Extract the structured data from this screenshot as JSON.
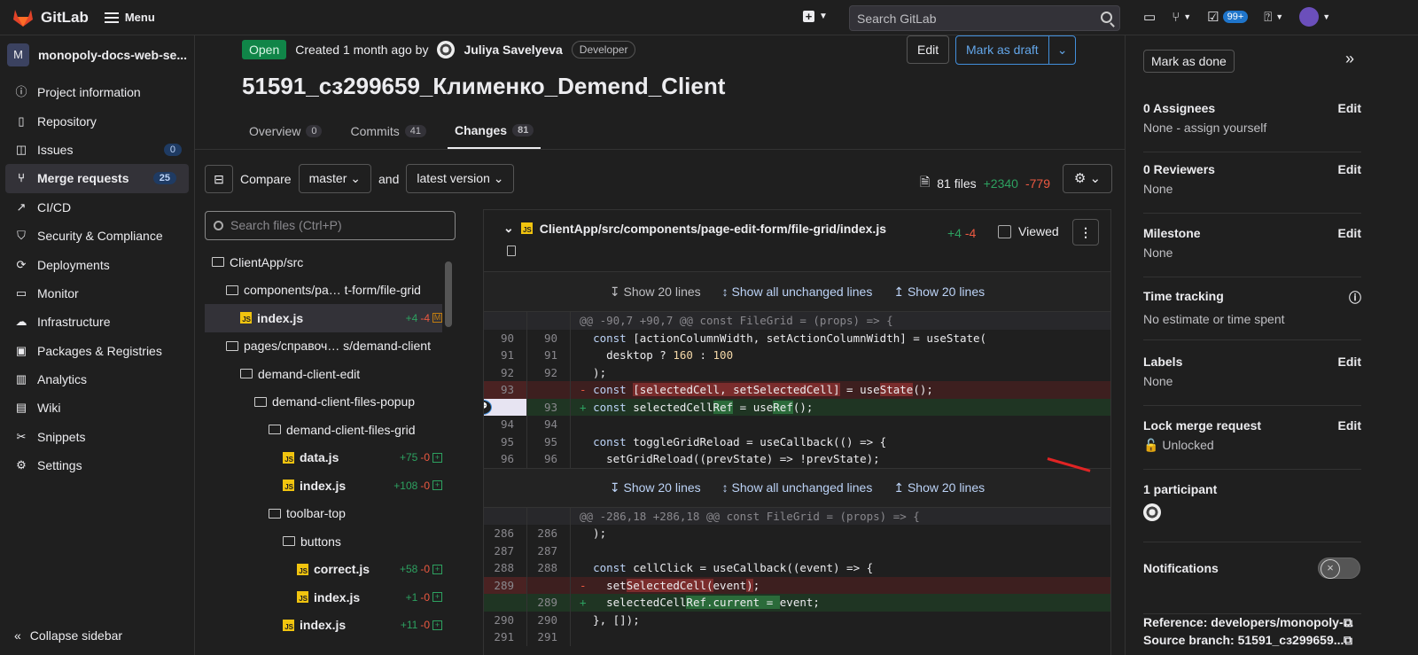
{
  "topbar": {
    "app": "GitLab",
    "menu": "Menu",
    "search_placeholder": "Search GitLab",
    "todos": "99+"
  },
  "sidebar": {
    "project": "monopoly-docs-web-se...",
    "items": [
      {
        "label": "Project information",
        "icon": "info-icon"
      },
      {
        "label": "Repository",
        "icon": "book-icon"
      },
      {
        "label": "Issues",
        "icon": "issues-icon",
        "badge": "0"
      },
      {
        "label": "Merge requests",
        "icon": "merge-icon",
        "badge": "25"
      },
      {
        "label": "CI/CD",
        "icon": "rocket-icon"
      },
      {
        "label": "Security & Compliance",
        "icon": "shield-icon"
      },
      {
        "label": "Deployments",
        "icon": "deploy-icon"
      },
      {
        "label": "Monitor",
        "icon": "monitor-icon"
      },
      {
        "label": "Infrastructure",
        "icon": "cloud-icon"
      },
      {
        "label": "Packages & Registries",
        "icon": "package-icon"
      },
      {
        "label": "Analytics",
        "icon": "chart-icon"
      },
      {
        "label": "Wiki",
        "icon": "wiki-icon"
      },
      {
        "label": "Snippets",
        "icon": "scissors-icon"
      },
      {
        "label": "Settings",
        "icon": "gear-icon"
      }
    ],
    "collapse": "Collapse sidebar"
  },
  "mr": {
    "status": "Open",
    "created": "Created 1 month ago by",
    "author": "Juliya Savelyeva",
    "role": "Developer",
    "edit": "Edit",
    "draft": "Mark as draft",
    "title": "51591_сз299659_Клименко_Demend_Client",
    "tabs": [
      {
        "label": "Overview",
        "count": "0"
      },
      {
        "label": "Commits",
        "count": "41"
      },
      {
        "label": "Changes",
        "count": "81"
      }
    ]
  },
  "compare": {
    "label": "Compare",
    "base": "master",
    "and": "and",
    "head": "latest version",
    "files": "81 files",
    "added": "+2340",
    "removed": "-779"
  },
  "tree": {
    "search_placeholder": "Search files (Ctrl+P)",
    "items": [
      {
        "name": "ClientApp/src",
        "type": "folder"
      },
      {
        "name": "components/pa… t-form/file-grid",
        "type": "folder"
      },
      {
        "name": "index.js",
        "type": "file",
        "add": "+4",
        "del": "-4",
        "mod": "M"
      },
      {
        "name": "pages/справоч… s/demand-client",
        "type": "folder"
      },
      {
        "name": "demand-client-edit",
        "type": "folder"
      },
      {
        "name": "demand-client-files-popup",
        "type": "folder"
      },
      {
        "name": "demand-client-files-grid",
        "type": "folder"
      },
      {
        "name": "data.js",
        "type": "file",
        "add": "+75",
        "del": "-0",
        "mod": "+"
      },
      {
        "name": "index.js",
        "type": "file",
        "add": "+108",
        "del": "-0",
        "mod": "+"
      },
      {
        "name": "toolbar-top",
        "type": "folder"
      },
      {
        "name": "buttons",
        "type": "folder"
      },
      {
        "name": "correct.js",
        "type": "file",
        "add": "+58",
        "del": "-0",
        "mod": "+"
      },
      {
        "name": "index.js",
        "type": "file",
        "add": "+1",
        "del": "-0",
        "mod": "+"
      },
      {
        "name": "index.js",
        "type": "file",
        "add": "+11",
        "del": "-0",
        "mod": "+"
      }
    ]
  },
  "diff": {
    "path": "ClientApp/src/components/page-edit-form/file-grid/index.js",
    "add": "+4",
    "del": "-4",
    "viewed": "Viewed",
    "expand": {
      "up": "Show 20 lines",
      "all": "Show all unchanged lines",
      "down": "Show 20 lines"
    }
  },
  "right": {
    "done": "Mark as done",
    "assignees": {
      "title": "0 Assignees",
      "edit": "Edit",
      "value": "None - assign yourself"
    },
    "reviewers": {
      "title": "0 Reviewers",
      "edit": "Edit",
      "value": "None"
    },
    "milestone": {
      "title": "Milestone",
      "edit": "Edit",
      "value": "None"
    },
    "time": {
      "title": "Time tracking",
      "value": "No estimate or time spent"
    },
    "labels": {
      "title": "Labels",
      "edit": "Edit",
      "value": "None"
    },
    "lock": {
      "title": "Lock merge request",
      "edit": "Edit",
      "value": "Unlocked"
    },
    "participants": {
      "title": "1 participant"
    },
    "notifications": {
      "title": "Notifications"
    },
    "reference": "Reference: developers/monopoly-...",
    "source": "Source branch: 51591_сз299659..."
  }
}
